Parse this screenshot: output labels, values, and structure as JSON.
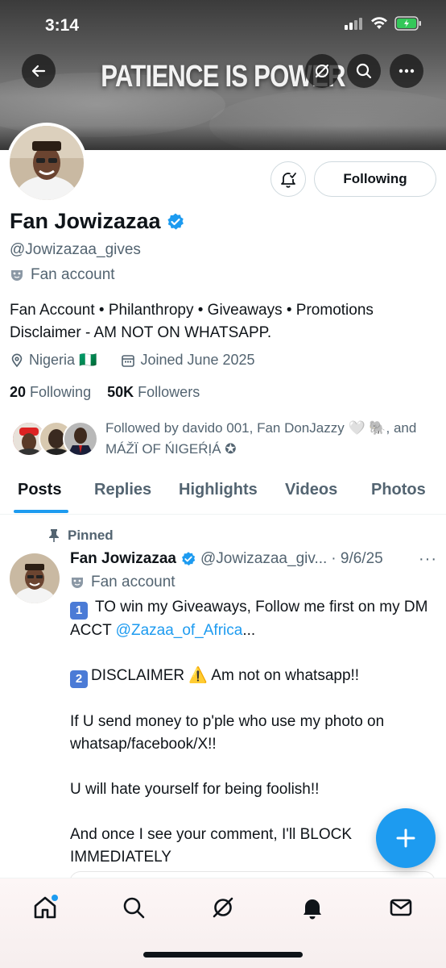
{
  "status_bar": {
    "time": "3:14"
  },
  "banner": {
    "text": "PATIENCE IS POWER"
  },
  "profile": {
    "name": "Fan Jowizazaa",
    "handle": "@Jowizazaa_gives",
    "account_label": "Fan account",
    "bio": "Fan Account • Philanthropy • Giveaways • Promotions Disclaimer - AM NOT ON WHATSAPP.",
    "location": "Nigeria 🇳🇬",
    "joined": "Joined June 2025",
    "following_count": "20",
    "following_label": "Following",
    "followers_count": "50K",
    "followers_label": "Followers",
    "followed_by": "Followed by davido 001, Fan DonJazzy 🤍 🐘, and MÁŽÏ OF ŃIGEŔỊÁ ✪",
    "follow_button_label": "Following"
  },
  "tabs": [
    {
      "label": "Posts",
      "active": true
    },
    {
      "label": "Replies",
      "active": false
    },
    {
      "label": "Highlights",
      "active": false
    },
    {
      "label": "Videos",
      "active": false
    },
    {
      "label": "Photos",
      "active": false
    }
  ],
  "post": {
    "pinned_label": "Pinned",
    "author": "Fan Jowizazaa",
    "handle": "@Jowizazaa_giv...",
    "date": "· 9/6/25",
    "account_label": "Fan account",
    "key1": "1",
    "line1": "TO win my Giveaways,  Follow me first on my DM ACCT",
    "link": "@Zazaa_of_Africa",
    "ellipsis": "...",
    "key2": "2",
    "line2": "DISCLAIMER ⚠️ Am not on whatsapp!!",
    "line3": "If U send money to p'ple who use my photo on whatsap/facebook/X!!",
    "line4": "U will hate yourself for being foolish!!",
    "line5": "And once I see your comment, I'll BLOCK IMMEDIATELY"
  },
  "colors": {
    "accent": "#1d9bf0",
    "text": "#0f1419",
    "muted": "#536471",
    "verified": "#1d9bf0"
  },
  "icons": [
    "back-icon",
    "grok-icon",
    "search-icon",
    "more-icon",
    "bell-check-icon",
    "verified-icon",
    "mask-icon",
    "location-icon",
    "calendar-icon",
    "pin-icon",
    "plus-icon",
    "home-icon",
    "nav-search-icon",
    "nav-grok-icon",
    "notifications-icon",
    "messages-icon"
  ]
}
